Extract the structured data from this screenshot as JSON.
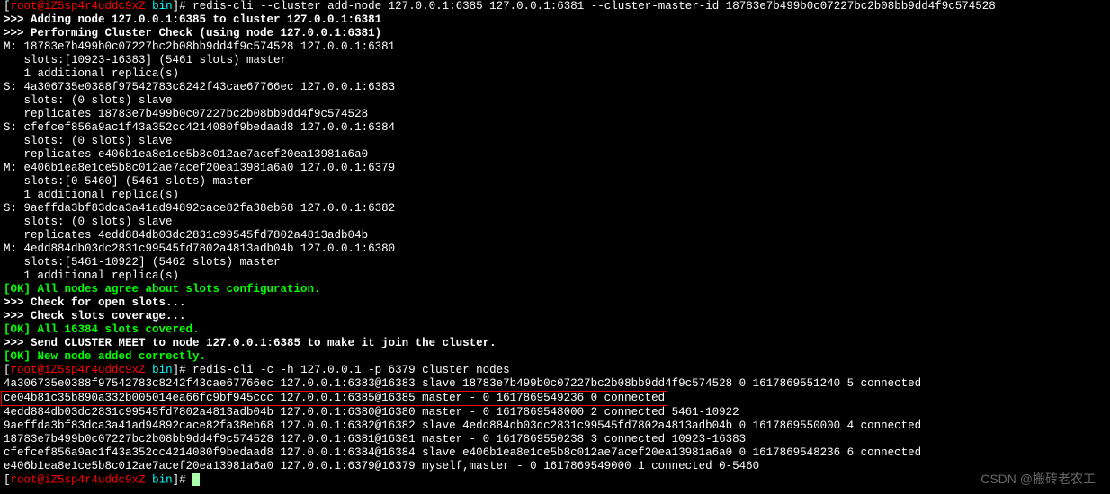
{
  "prompt": {
    "user": "root",
    "at": "@",
    "host": "iZ5sp4r4uddc9xZ",
    "path": "bin",
    "hash": "]# "
  },
  "cmd1": "redis-cli --cluster add-node 127.0.0.1:6385 127.0.0.1:6381 --cluster-master-id 18783e7b499b0c07227bc2b08bb9dd4f9c574528",
  "out": {
    "l0": ">>> Adding node 127.0.0.1:6385 to cluster 127.0.0.1:6381",
    "l1": ">>> Performing Cluster Check (using node 127.0.0.1:6381)",
    "l2": "M: 18783e7b499b0c07227bc2b08bb9dd4f9c574528 127.0.0.1:6381",
    "l3": "   slots:[10923-16383] (5461 slots) master",
    "l4": "   1 additional replica(s)",
    "l5": "S: 4a306735e0388f97542783c8242f43cae67766ec 127.0.0.1:6383",
    "l6": "   slots: (0 slots) slave",
    "l7": "   replicates 18783e7b499b0c07227bc2b08bb9dd4f9c574528",
    "l8": "S: cfefcef856a9ac1f43a352cc4214080f9bedaad8 127.0.0.1:6384",
    "l9": "   slots: (0 slots) slave",
    "l10": "   replicates e406b1ea8e1ce5b8c012ae7acef20ea13981a6a0",
    "l11": "M: e406b1ea8e1ce5b8c012ae7acef20ea13981a6a0 127.0.0.1:6379",
    "l12": "   slots:[0-5460] (5461 slots) master",
    "l13": "   1 additional replica(s)",
    "l14": "S: 9aeffda3bf83dca3a41ad94892cace82fa38eb68 127.0.0.1:6382",
    "l15": "   slots: (0 slots) slave",
    "l16": "   replicates 4edd884db03dc2831c99545fd7802a4813adb04b",
    "l17": "M: 4edd884db03dc2831c99545fd7802a4813adb04b 127.0.0.1:6380",
    "l18": "   slots:[5461-10922] (5462 slots) master",
    "l19": "   1 additional replica(s)",
    "ok1": "[OK] All nodes agree about slots configuration.",
    "l20": ">>> Check for open slots...",
    "l21": ">>> Check slots coverage...",
    "ok2": "[OK] All 16384 slots covered.",
    "l22": ">>> Send CLUSTER MEET to node 127.0.0.1:6385 to make it join the cluster.",
    "ok3": "[OK] New node added correctly."
  },
  "cmd2": "redis-cli -c -h 127.0.0.1 -p 6379 cluster nodes",
  "nodes": {
    "n0": "4a306735e0388f97542783c8242f43cae67766ec 127.0.0.1:6383@16383 slave 18783e7b499b0c07227bc2b08bb9dd4f9c574528 0 1617869551240 5 connected",
    "n1": "ce04b81c35b890a332b005014ea66fc9bf945ccc 127.0.0.1:6385@16385 master - 0 1617869549236 0 connected",
    "n2": "4edd884db03dc2831c99545fd7802a4813adb04b 127.0.0.1:6380@16380 master - 0 1617869548000 2 connected 5461-10922",
    "n3": "9aeffda3bf83dca3a41ad94892cace82fa38eb68 127.0.0.1:6382@16382 slave 4edd884db03dc2831c99545fd7802a4813adb04b 0 1617869550000 4 connected",
    "n4": "18783e7b499b0c07227bc2b08bb9dd4f9c574528 127.0.0.1:6381@16381 master - 0 1617869550238 3 connected 10923-16383",
    "n5": "cfefcef856a9ac1f43a352cc4214080f9bedaad8 127.0.0.1:6384@16384 slave e406b1ea8e1ce5b8c012ae7acef20ea13981a6a0 0 1617869548236 6 connected",
    "n6": "e406b1ea8e1ce5b8c012ae7acef20ea13981a6a0 127.0.0.1:6379@16379 myself,master - 0 1617869549000 1 connected 0-5460"
  },
  "watermark": "CSDN @搬砖老农工"
}
